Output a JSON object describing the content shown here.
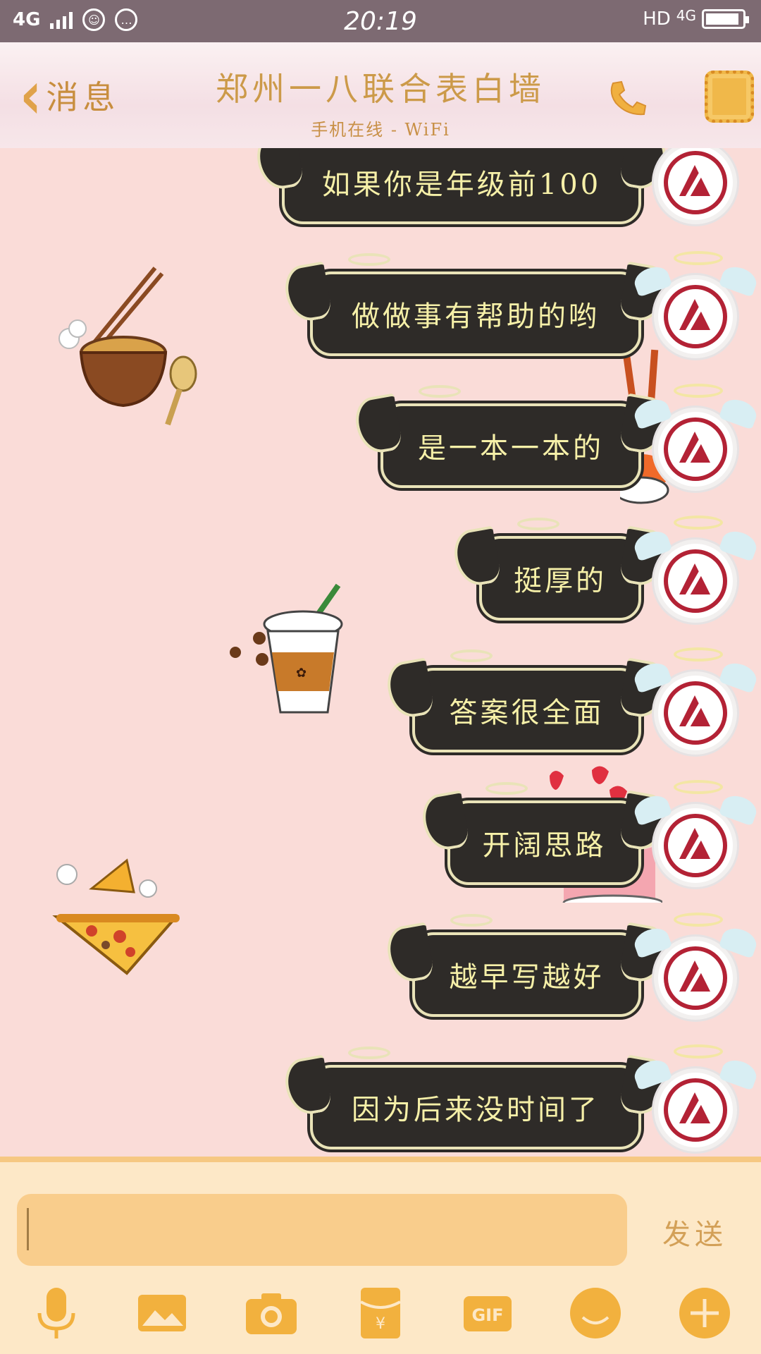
{
  "status_bar": {
    "network_left": "4G",
    "time": "20:19",
    "hd": "HD",
    "network_right": "4G"
  },
  "header": {
    "back_label": "消息",
    "title": "郑州一八联合表白墙",
    "subtitle": "手机在线 - WiFi"
  },
  "messages": [
    {
      "text": "如果你是年级前100"
    },
    {
      "text": "做做事有帮助的哟"
    },
    {
      "text": "是一本一本的"
    },
    {
      "text": "挺厚的"
    },
    {
      "text": "答案很全面"
    },
    {
      "text": "开阔思路"
    },
    {
      "text": "越早写越好"
    },
    {
      "text": "因为后来没时间了"
    }
  ],
  "input": {
    "value": "",
    "send_label": "发送"
  },
  "toolbar_icons": [
    "microphone-icon",
    "image-icon",
    "camera-icon",
    "red-packet-icon",
    "gif-icon",
    "emoji-icon",
    "plus-icon"
  ],
  "toolbar": {
    "gif_label": "GIF",
    "packet_label": "¥"
  },
  "colors": {
    "status_bar": "#7d6a72",
    "chat_background": "#fadcd8",
    "bubble": "#2e2b28",
    "bubble_text": "#f6f0a8",
    "accent": "#e0a24a",
    "input_bar": "#fde8c7"
  }
}
